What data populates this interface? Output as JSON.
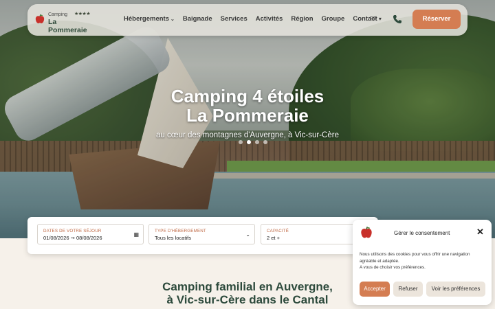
{
  "nav": {
    "logo_small": "Camping",
    "logo_stars": "★★★★",
    "logo_main": "La Pommeraie",
    "menu": [
      "Hébergements",
      "Baignade",
      "Services",
      "Activités",
      "Région",
      "Groupe",
      "Contact"
    ],
    "lang": "FR ▾",
    "reserve_label": "Réserver"
  },
  "hero": {
    "title_line1": "Camping 4 étoiles",
    "title_line2": "La Pommeraie",
    "subtitle": "au cœur des montagnes d'Auvergne, à Vic-sur-Cère"
  },
  "search": {
    "dates": {
      "label": "Dates de votre séjour",
      "value": "01/08/2026 ➞ 08/08/2026"
    },
    "type": {
      "label": "Type d'hébergement",
      "value": "Tous les locatifs"
    },
    "capacity": {
      "label": "Capacité",
      "value": "2 et +"
    }
  },
  "section": {
    "title_line1": "Camping familial en Auvergne,",
    "title_line2": "à Vic-sur-Cère dans le Cantal"
  },
  "consent": {
    "title": "Gérer le consentement",
    "text_line1": "Nous utilisons des cookies pour vous offrir une navigation agréable et adaptée.",
    "text_line2": "A vous de choisir vos préférences.",
    "accept": "Accepter",
    "refuse": "Refuser",
    "prefs": "Voir les préférences"
  },
  "colors": {
    "accent": "#d47d52",
    "brand_green": "#2d4a3c"
  }
}
